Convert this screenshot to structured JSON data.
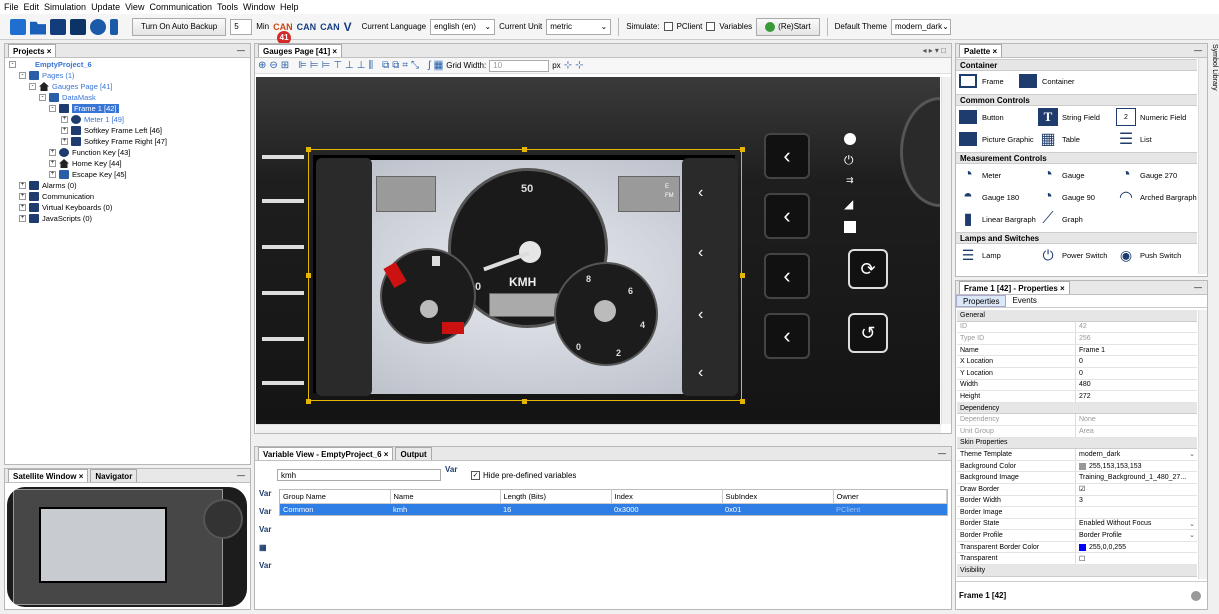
{
  "menu": [
    "File",
    "Edit",
    "Simulation",
    "Update",
    "View",
    "Communication",
    "Tools",
    "Window",
    "Help"
  ],
  "toolbar": {
    "auto_backup": "Turn On Auto Backup",
    "backup_minutes": "5",
    "minutes_unit": "Min",
    "lang_label": "Current Language",
    "lang_value": "english (en)",
    "unit_label": "Current Unit",
    "unit_value": "metric",
    "simulate_label": "Simulate:",
    "pclient_label": "PClient",
    "variables_label": "Variables",
    "restart_label": "(Re)Start",
    "theme_label": "Default Theme",
    "theme_value": "modern_dark",
    "badge": "41",
    "can_text": "CAN"
  },
  "projects": {
    "tab": "Projects",
    "items": [
      {
        "label": "EmptyProject_6"
      },
      {
        "label": "Pages (1)"
      },
      {
        "label": "Gauges Page [41]"
      },
      {
        "label": "DataMask"
      },
      {
        "label": "Frame 1 [42]"
      },
      {
        "label": "Meter 1 [49]"
      },
      {
        "label": "Softkey Frame Left [46]"
      },
      {
        "label": "Softkey Frame Right [47]"
      },
      {
        "label": "Function Key [43]"
      },
      {
        "label": "Home Key [44]"
      },
      {
        "label": "Escape Key [45]"
      },
      {
        "label": "Alarms (0)"
      },
      {
        "label": "Communication"
      },
      {
        "label": "Virtual Keyboards (0)"
      },
      {
        "label": "JavaScripts (0)"
      }
    ]
  },
  "satellite": {
    "tab1": "Satellite Window",
    "tab2": "Navigator"
  },
  "editor": {
    "tab": "Gauges Page [41]",
    "grid_label": "Grid Width:",
    "grid_value": "10",
    "grid_unit": "px",
    "gauge_speed_label": "KMH",
    "gauge_speed_top": "50",
    "gauge_speed_left": "0",
    "gauge_speed_right": "100",
    "gauge_rpm": [
      "8",
      "6",
      "4",
      "2",
      "0"
    ],
    "side_labels": [
      "E",
      "FM"
    ]
  },
  "varview": {
    "tab1": "Variable View - EmptyProject_6",
    "tab2": "Output",
    "search": "kmh",
    "hide_label": "Hide pre-defined variables",
    "var_label": "Var",
    "columns": [
      "Group Name",
      "Name",
      "Length (Bits)",
      "Index",
      "SubIndex",
      "Owner"
    ],
    "rows": [
      [
        "Common",
        "kmh",
        "16",
        "0x3000",
        "0x01",
        "PClient"
      ]
    ]
  },
  "palette": {
    "tab": "Palette",
    "side_label": "Symbol Library",
    "sections": [
      {
        "title": "Container",
        "items": [
          "Frame",
          "Container"
        ]
      },
      {
        "title": "Common Controls",
        "items": [
          "Button",
          "String Field",
          "Numeric Field",
          "Picture Graphic",
          "Table",
          "List"
        ]
      },
      {
        "title": "Measurement Controls",
        "items": [
          "Meter",
          "Gauge",
          "Gauge 270",
          "Gauge 180",
          "Gauge 90",
          "Arched Bargraph",
          "Linear Bargraph",
          "Graph"
        ]
      },
      {
        "title": "Lamps and Switches",
        "items": [
          "Lamp",
          "Power Switch",
          "Push Switch"
        ]
      }
    ]
  },
  "properties": {
    "tab": "Frame 1 [42] - Properties",
    "subtabs": [
      "Properties",
      "Events"
    ],
    "footer": "Frame 1 [42]",
    "rows": [
      {
        "type": "section",
        "k": "General"
      },
      {
        "k": "ID",
        "v": "42",
        "grey": true
      },
      {
        "k": "Type ID",
        "v": "256",
        "grey": true
      },
      {
        "k": "Name",
        "v": "Frame 1"
      },
      {
        "k": "X Location",
        "v": "0"
      },
      {
        "k": "Y Location",
        "v": "0"
      },
      {
        "k": "Width",
        "v": "480"
      },
      {
        "k": "Height",
        "v": "272"
      },
      {
        "type": "section",
        "k": "Dependency"
      },
      {
        "k": "Dependency",
        "v": "None",
        "grey": true
      },
      {
        "k": "Unit Group",
        "v": "Area",
        "grey": true
      },
      {
        "type": "section",
        "k": "Skin Properties"
      },
      {
        "k": "Theme Template",
        "v": "modern_dark"
      },
      {
        "k": "Background Color",
        "v": "255,153,153,153"
      },
      {
        "k": "Background Image",
        "v": "Training_Background_1_480_27..."
      },
      {
        "k": "Draw Border",
        "v": "☑"
      },
      {
        "k": "Border Width",
        "v": "3"
      },
      {
        "k": "Border Image",
        "v": ""
      },
      {
        "k": "Border State",
        "v": "Enabled Without Focus"
      },
      {
        "k": "Border Profile",
        "v": "Border Profile"
      },
      {
        "k": "Transparent Border Color",
        "v": "255,0,0,255"
      },
      {
        "k": "Transparent",
        "v": "☐"
      },
      {
        "type": "section",
        "k": "Visibility"
      }
    ]
  }
}
